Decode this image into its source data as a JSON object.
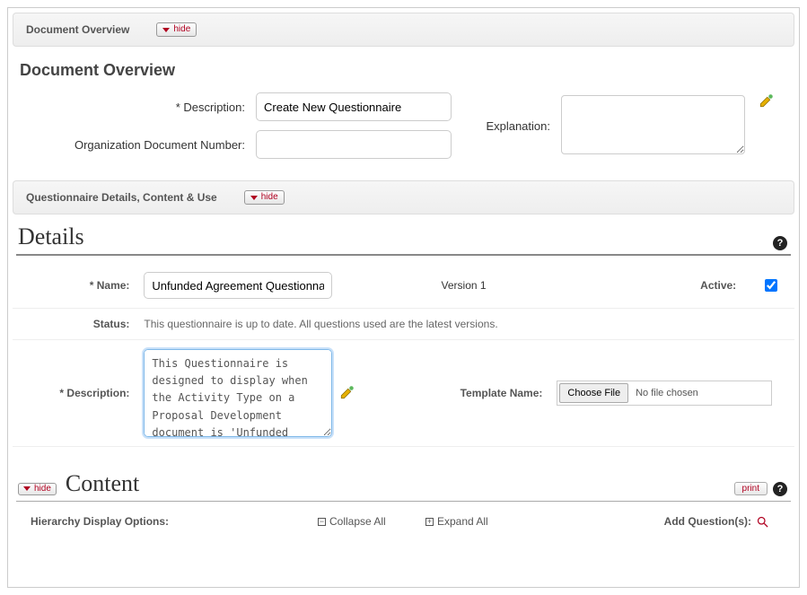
{
  "sections": {
    "overview_header": "Document Overview",
    "details_header": "Questionnaire Details, Content & Use"
  },
  "hide_label": "hide",
  "overview": {
    "heading": "Document Overview",
    "description_label": "*   Description:",
    "description_value": "Create New Questionnaire",
    "orgdoc_label": "Organization Document Number:",
    "orgdoc_value": "",
    "explanation_label": "Explanation:",
    "explanation_value": ""
  },
  "details": {
    "heading": "Details",
    "name_label": "*  Name:",
    "name_value": "Unfunded Agreement Questionnaire",
    "version_label": "Version 1",
    "active_label": "Active:",
    "active_checked": true,
    "status_label": "Status:",
    "status_text": "This questionnaire is up to date. All questions used are the latest versions.",
    "description_label": "*  Description:",
    "description_value": "This Questionnaire is designed to display when the Activity Type on a Proposal Development document is 'Unfunded Agreement.",
    "template_label": "Template Name:",
    "choose_file_label": "Choose File",
    "no_file_text": "No file chosen"
  },
  "content": {
    "heading": "Content",
    "print_label": "print",
    "hierarchy_label": "Hierarchy Display Options:",
    "collapse_label": "Collapse All",
    "expand_label": "Expand All",
    "addq_label": "Add Question(s):"
  }
}
